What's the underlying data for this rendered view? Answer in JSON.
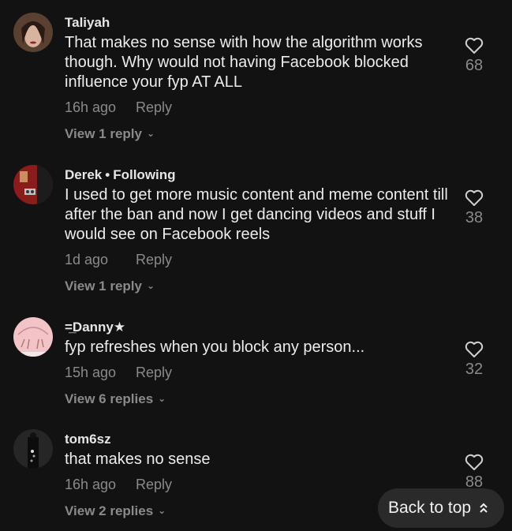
{
  "comments": [
    {
      "username": "Taliyah",
      "following": "",
      "text": "That makes no sense with how the algorithm works though. Why would not having Facebook blocked influence your fyp AT ALL",
      "time": "16h ago",
      "reply_label": "Reply",
      "view_replies": "View 1 reply",
      "likes": "68"
    },
    {
      "username": "Derek",
      "following": "Following",
      "text": "I used to get more music content and meme content till after the ban and now I get dancing videos and stuff I would see on Facebook reels",
      "time": "1d ago",
      "reply_label": "Reply",
      "view_replies": "View 1 reply",
      "likes": "38"
    },
    {
      "username": "=̲Danny★",
      "following": "",
      "text": "fyp refreshes when you block any person...",
      "time": "15h ago",
      "reply_label": "Reply",
      "view_replies": "View 6 replies",
      "likes": "32"
    },
    {
      "username": "tom6sz",
      "following": "",
      "text": "that makes no sense",
      "time": "16h ago",
      "reply_label": "Reply",
      "view_replies": "View 2 replies",
      "likes": "88"
    }
  ],
  "icons": {
    "like": "heart-outline-icon",
    "expand": "chevron-down-icon",
    "back_top": "double-chevron-up-icon"
  },
  "back_to_top_label": "Back to top",
  "colors": {
    "background": "#121212",
    "muted_text": "#8a8a8a",
    "button_bg": "#2a2a2a"
  }
}
